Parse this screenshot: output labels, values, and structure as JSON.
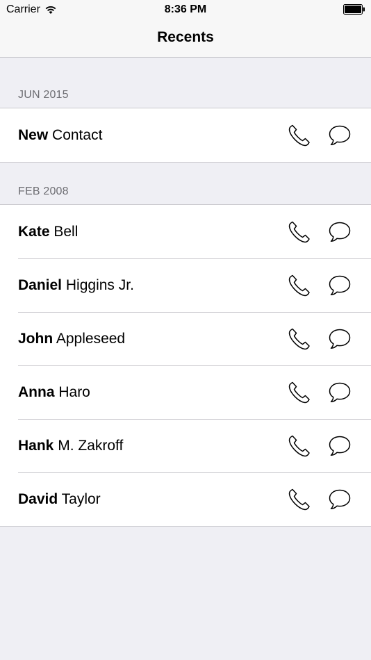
{
  "status_bar": {
    "carrier": "Carrier",
    "time": "8:36 PM"
  },
  "nav": {
    "title": "Recents"
  },
  "sections": [
    {
      "header": "JUN 2015",
      "contacts": [
        {
          "first": "New",
          "last": "Contact"
        }
      ]
    },
    {
      "header": "FEB 2008",
      "contacts": [
        {
          "first": "Kate",
          "last": "Bell"
        },
        {
          "first": "Daniel",
          "last": "Higgins Jr."
        },
        {
          "first": "John",
          "last": "Appleseed"
        },
        {
          "first": "Anna",
          "last": "Haro"
        },
        {
          "first": "Hank",
          "last": "M. Zakroff"
        },
        {
          "first": "David",
          "last": "Taylor"
        }
      ]
    }
  ],
  "icons": {
    "call": "phone-icon",
    "message": "message-bubble-icon",
    "wifi": "wifi-icon",
    "battery": "battery-icon"
  }
}
